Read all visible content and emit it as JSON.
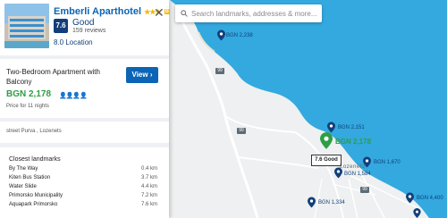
{
  "hotel": {
    "name": "Emberli Aparthotel",
    "stars": "★★★",
    "badge": "B",
    "score": "7.6",
    "rating_word": "Good",
    "reviews": "159 reviews",
    "location_score": "8.0 Location"
  },
  "offer": {
    "room": "Two-Bedroom Apartment with Balcony",
    "price": "BGN 2,178",
    "nights": "Price for 11 nights",
    "view_label": "View"
  },
  "address": "street Purva , Lozenets",
  "landmarks": {
    "title": "Closest landmarks",
    "items": [
      {
        "name": "By The Way",
        "distance": "0.4 km"
      },
      {
        "name": "Kiten Bus Station",
        "distance": "3.7 km"
      },
      {
        "name": "Water Slide",
        "distance": "4.4 km"
      },
      {
        "name": "Primorsko Municipality",
        "distance": "7.2 km"
      },
      {
        "name": "Aquapark Primorsko",
        "distance": "7.6 km"
      }
    ]
  },
  "search": {
    "placeholder": "Search landmarks, addresses & more..."
  },
  "map": {
    "pins": [
      "BGN 2,238",
      "BGN 2,151",
      "BGN 2,178",
      "BGN 1,584",
      "BGN 1,670",
      "BGN 1,334",
      "BGN 4,400"
    ],
    "tooltip": "7.6 Good",
    "town": "Lozenets",
    "road_labels": [
      "99",
      "99",
      "99"
    ],
    "colors": {
      "sea": "#33a9df",
      "land": "#eef0f1",
      "pin": "#123f7a",
      "selected_pin": "#2e9e45"
    }
  }
}
